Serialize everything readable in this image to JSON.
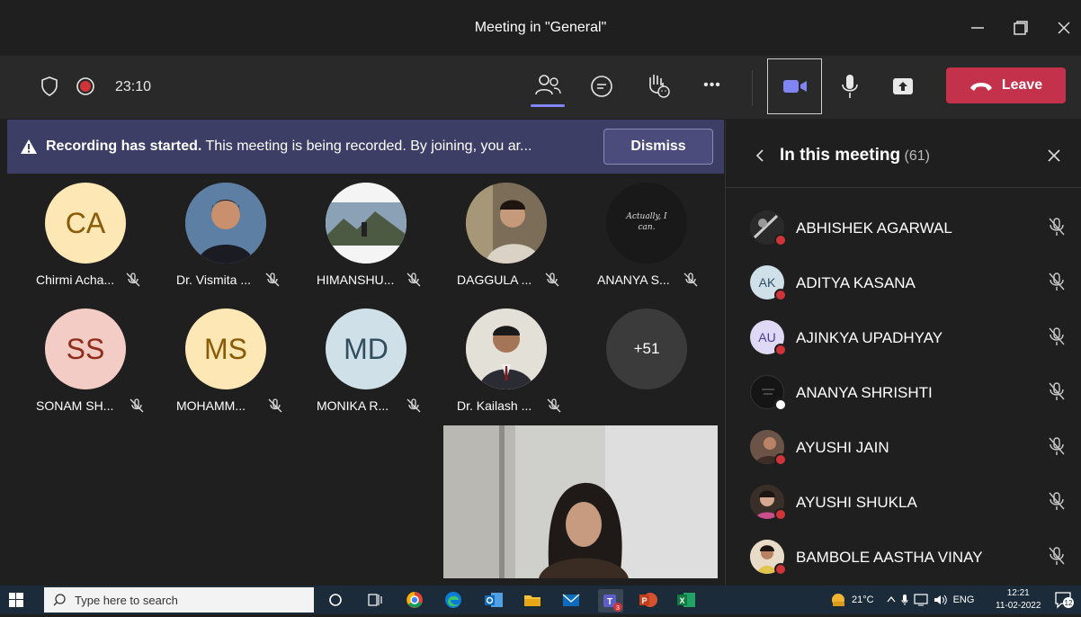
{
  "window": {
    "title": "Meeting in \"General\"",
    "minimize_icon": "minimize-icon",
    "restore_icon": "restore-icon",
    "close_icon": "close-icon"
  },
  "toolbar": {
    "timer": "23:10",
    "leave_label": "Leave",
    "more_label": "•••"
  },
  "banner": {
    "bold_text": "Recording has started.",
    "text": " This meeting is being recorded. By joining, you ar...",
    "dismiss_label": "Dismiss"
  },
  "tiles": [
    {
      "name": "Chirmi Acha...",
      "initials": "CA",
      "bg": "#fde7b5",
      "fg": "#8a5b06"
    },
    {
      "name": "Dr. Vismita ...",
      "initials": "",
      "bg": "#6a7a8a",
      "fg": "#fff"
    },
    {
      "name": "HIMANSHU...",
      "initials": "",
      "bg": "#8fa3b8",
      "fg": "#fff"
    },
    {
      "name": "DAGGULA ...",
      "initials": "",
      "bg": "#6f6656",
      "fg": "#fff"
    },
    {
      "name": "ANANYA S...",
      "initials": "Actually, I can.",
      "bg": "#191919",
      "fg": "#ddd"
    },
    {
      "name": "SONAM SH...",
      "initials": "SS",
      "bg": "#f3cdc5",
      "fg": "#8f2d1c"
    },
    {
      "name": "MOHAMM...",
      "initials": "MS",
      "bg": "#fde7b5",
      "fg": "#8a5b06"
    },
    {
      "name": "MONIKA R...",
      "initials": "MD",
      "bg": "#cfe0e8",
      "fg": "#2f4e60"
    },
    {
      "name": "Dr. Kailash ...",
      "initials": "",
      "bg": "#b7b4ad",
      "fg": "#fff"
    },
    {
      "name": "",
      "initials": "+51",
      "bg": "#3b3b3b",
      "fg": "#fff"
    }
  ],
  "panel": {
    "title": "In this meeting",
    "count": " (61)",
    "participants": [
      {
        "name": "ABHISHEK AGARWAL",
        "initials": "",
        "bg": "#333",
        "status": "#d13438"
      },
      {
        "name": "ADITYA KASANA",
        "initials": "AK",
        "bg": "#cfe0e8",
        "status": "#d13438"
      },
      {
        "name": "AJINKYA UPADHYAY",
        "initials": "AU",
        "bg": "#e0d9f5",
        "status": "#d13438"
      },
      {
        "name": "ANANYA SHRISHTI",
        "initials": "",
        "bg": "#151515",
        "status": "#ffffff"
      },
      {
        "name": "AYUSHI JAIN",
        "initials": "",
        "bg": "#5a4a42",
        "status": "#d13438"
      },
      {
        "name": "AYUSHI SHUKLA",
        "initials": "",
        "bg": "#4a3c34",
        "status": "#d13438"
      },
      {
        "name": "BAMBOLE AASTHA VINAY",
        "initials": "",
        "bg": "#d7c3a8",
        "status": "#d13438"
      }
    ]
  },
  "taskbar": {
    "search_placeholder": "Type here to search",
    "temperature": "21°C",
    "language": "ENG",
    "time": "12:21",
    "date": "11-02-2022",
    "notification_count": "12"
  }
}
